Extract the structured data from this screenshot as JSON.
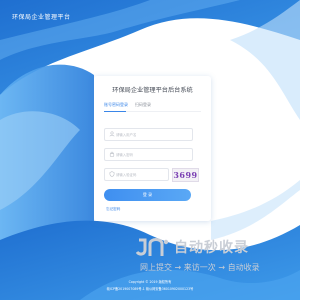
{
  "header": {
    "brand": "环保局企业管理平台"
  },
  "login": {
    "title": "环保局企业管理平台后台系统",
    "tabs": [
      {
        "label": "账号密码登录",
        "active": true
      },
      {
        "label": "扫码登录",
        "active": false
      }
    ],
    "username_placeholder": "请输入用户名",
    "password_placeholder": "请输入密码",
    "captcha_placeholder": "请输入验证码",
    "captcha_text": "3699",
    "submit_label": "登 录",
    "forgot_label": "忘记密码"
  },
  "watermark": {
    "title": "自动秒收录",
    "subtitle": "网上提交 → 来访一次 → 自动收录"
  },
  "footer": {
    "copyright": "Copyright © 2019 版权所有",
    "icp": "赣ICP备2019007089号-1 赣公网安备36010902000123号"
  },
  "colors": {
    "accent": "#3a86e8",
    "background_blue": "#2f7fd8",
    "card_bg": "#ffffff"
  },
  "icons": {
    "user": "user-icon",
    "lock": "lock-icon",
    "shield": "shield-icon"
  }
}
